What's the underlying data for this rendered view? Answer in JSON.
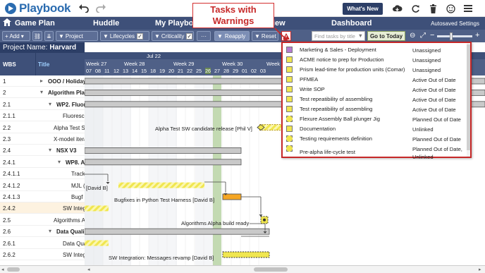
{
  "app": {
    "logo_text": "Playbook",
    "whats_new": "What's New",
    "autosaved": "Autosaved Settings"
  },
  "tabs": [
    "Game Plan",
    "Huddle",
    "My Playbo",
    "iew",
    "Dashboard"
  ],
  "callout": {
    "line1": "Tasks with",
    "line2": "Warnings"
  },
  "toolbar": {
    "add": "+ Add",
    "project": "Project",
    "lifecycles": "Lifecycles",
    "criticality": "Criticality",
    "more": "···",
    "reapply": "Reapply",
    "reset": "Reset",
    "search_placeholder": "Find tasks by title",
    "goto_today": "Go to Today"
  },
  "project": {
    "label": "Project Name:",
    "name": "Harvard"
  },
  "columns": {
    "wbs": "WBS",
    "title": "Title"
  },
  "timeline": {
    "month": "Jul 22",
    "weeks": [
      "Week 27",
      "Week 28",
      "Week 29",
      "Week 30",
      "Week 3"
    ],
    "days": [
      "07",
      "08",
      "11",
      "12",
      "13",
      "14",
      "15",
      "18",
      "19",
      "20",
      "21",
      "22",
      "25",
      "26",
      "27",
      "28",
      "29",
      "01",
      "02",
      "03"
    ]
  },
  "rows": [
    {
      "wbs": "1",
      "title": "OOO / Holiday",
      "bold": true,
      "indent": 68,
      "toggle": "▸"
    },
    {
      "wbs": "2",
      "title": "Algorithm Plan",
      "bold": true,
      "indent": 68,
      "toggle": "▾"
    },
    {
      "wbs": "2.1",
      "title": "WP2. Fluor",
      "bold": true,
      "indent": 80,
      "toggle": "▾"
    },
    {
      "wbs": "2.1.1",
      "title": "Fluoresce",
      "bold": false,
      "indent": 89,
      "toggle": ""
    },
    {
      "wbs": "2.2",
      "title": "Alpha Test S",
      "bold": false,
      "indent": 76,
      "toggle": ""
    },
    {
      "wbs": "2.3",
      "title": "X-model itera",
      "bold": false,
      "indent": 76,
      "toggle": ""
    },
    {
      "wbs": "2.4",
      "title": "NSX V3",
      "bold": true,
      "indent": 80,
      "toggle": "▾"
    },
    {
      "wbs": "2.4.1",
      "title": "WP8. A",
      "bold": true,
      "indent": 93,
      "toggle": "▾"
    },
    {
      "wbs": "2.4.1.1",
      "title": "Track",
      "bold": false,
      "indent": 101,
      "toggle": ""
    },
    {
      "wbs": "2.4.1.2",
      "title": "MJL (",
      "bold": false,
      "indent": 101,
      "toggle": ""
    },
    {
      "wbs": "2.4.1.3",
      "title": "Bugf",
      "bold": false,
      "indent": 101,
      "toggle": ""
    },
    {
      "wbs": "2.4.2",
      "title": "SW Integ",
      "bold": false,
      "indent": 89,
      "toggle": "",
      "highlight": true
    },
    {
      "wbs": "2.5",
      "title": "Algorithms A",
      "bold": false,
      "indent": 76,
      "toggle": ""
    },
    {
      "wbs": "2.6",
      "title": "Data Quali",
      "bold": true,
      "indent": 80,
      "toggle": "▾"
    },
    {
      "wbs": "2.6.1",
      "title": "Data Qua",
      "bold": false,
      "indent": 89,
      "toggle": ""
    },
    {
      "wbs": "2.6.2",
      "title": "SW Integ",
      "bold": false,
      "indent": 89,
      "toggle": ""
    }
  ],
  "gantt_labels": {
    "alpha_release": "Alpha Test SW candidate release [Phil V]",
    "david1": "[David B]",
    "bugfixes": "Bugfixes in Python Test Harness [David B]",
    "alg_build": "Algorithms Alpha build ready",
    "sw_msg": "SW Integration: Messages revamp [David B]"
  },
  "warnings": [
    {
      "name": "Marketing & Sales - Deployment",
      "status": "Unassigned",
      "icon": "purple-solid"
    },
    {
      "name": "ACME notice to prep for Production",
      "status": "Unassigned",
      "icon": "yellow-solid"
    },
    {
      "name": "Prism lead-time for production units (Comar)",
      "status": "Unassigned",
      "icon": "yellow-solid"
    },
    {
      "name": "PFMEA",
      "status": "Active Out of Date",
      "icon": "yellow-solid"
    },
    {
      "name": "Write SOP",
      "status": "Active Out of Date",
      "icon": "yellow-solid"
    },
    {
      "name": "Test repeatibility of assembling",
      "status": "Active Out of Date",
      "icon": "yellow-solid"
    },
    {
      "name": "Test repeatibility of assembling",
      "status": "Active Out of Date",
      "icon": "yellow-solid"
    },
    {
      "name": "Flexure Assembly Ball plunger Jig",
      "status": "Planned Out of Date",
      "icon": "yellow-dashed"
    },
    {
      "name": "Documentation",
      "status": "Unlinked",
      "icon": "yellow-solid"
    },
    {
      "name": "Testing requirements definition",
      "status": "Planned Out of Date",
      "icon": "yellow-dashed"
    },
    {
      "name": "Pre-alpha life-cycle test",
      "status": "Planned Out of Date,",
      "status2": "Unlinked",
      "icon": "yellow-dashed"
    }
  ],
  "colors": {
    "navy": "#2c3e66",
    "tab_bg": "#3e5079",
    "toolbar_bg": "#4f6087",
    "warning_red": "#c62828",
    "task_yellow": "#f0e650",
    "today_green": "#b9d3a5",
    "milestone_orange": "#f5a623"
  }
}
